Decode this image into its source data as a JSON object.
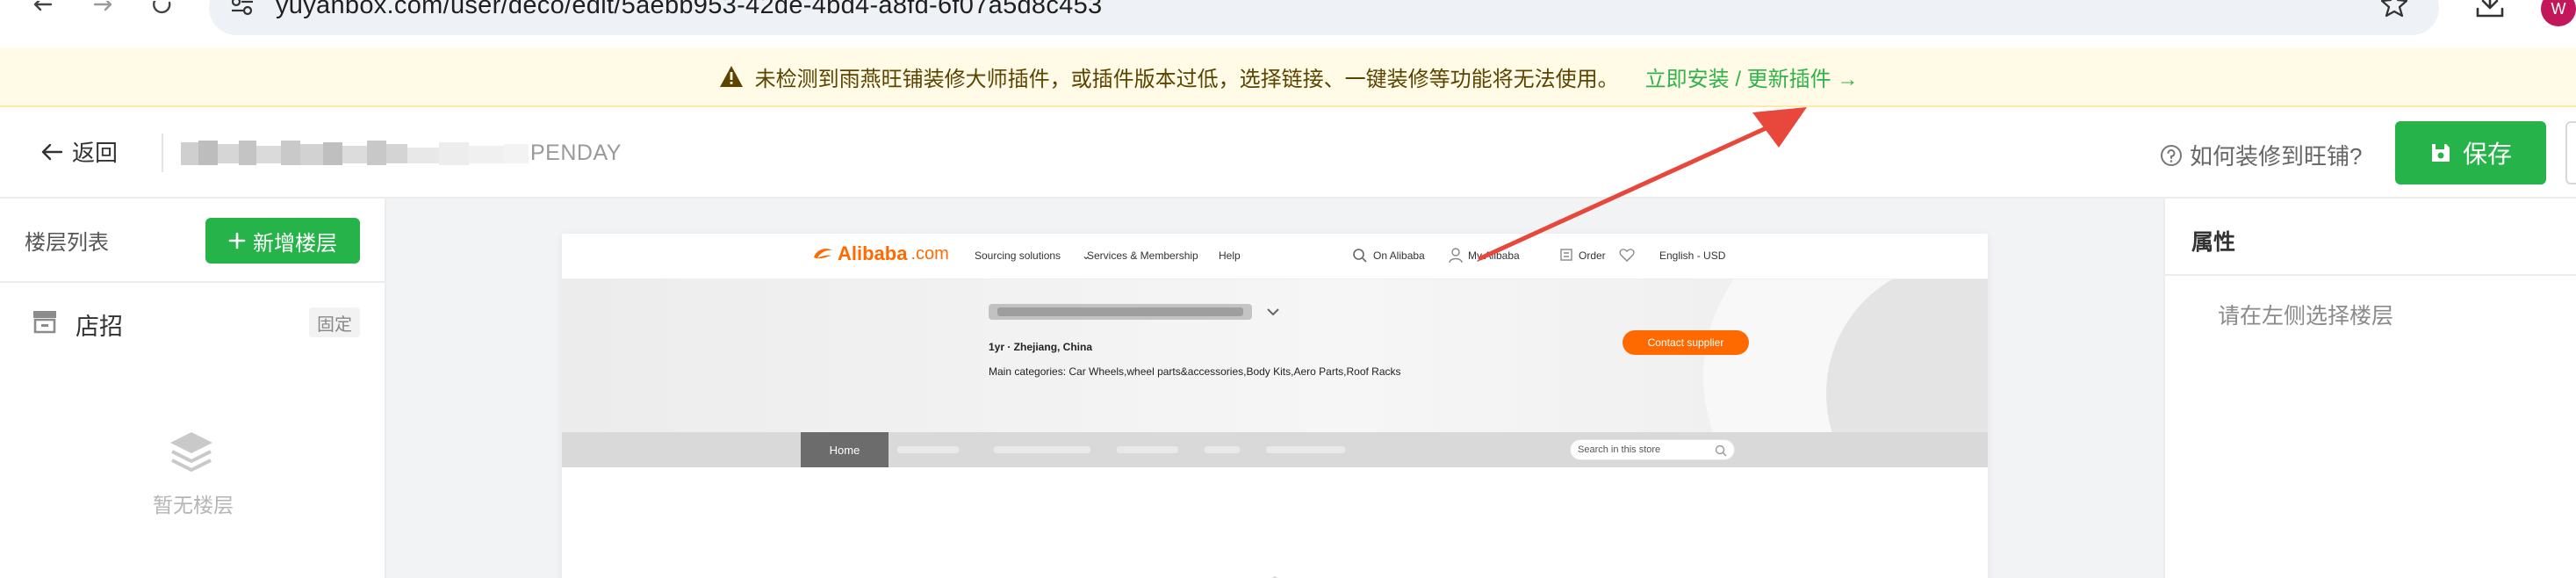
{
  "browser": {
    "url": "yuyanbox.com/user/deco/edit/5aebb953-42de-4bd4-a8fd-6f07a5d8c453",
    "avatar_initial": "W"
  },
  "banner": {
    "message": "未检测到雨燕旺铺装修大师插件，或插件版本过低，选择链接、一键装修等功能将无法使用。",
    "link": "立即安装 / 更新插件 →"
  },
  "header": {
    "back_label": "返回",
    "shop_suffix": "PENDAY",
    "help_label": "如何装修到旺铺?",
    "save_label": "保存"
  },
  "left_panel": {
    "title": "楼层列表",
    "add_label": "新增楼层",
    "store_label": "店招",
    "fixed_badge": "固定",
    "empty_text": "暂无楼层"
  },
  "preview": {
    "logo_main": "Alibaba",
    "logo_suffix": ".com",
    "nav": {
      "sourcing": "Sourcing solutions",
      "services": "Services & Membership",
      "help": "Help",
      "on_alibaba": "On Alibaba",
      "my_alibaba": "My Alibaba",
      "order": "Order",
      "language": "English - USD"
    },
    "company_meta": "1yr  ·  Zhejiang, China",
    "main_categories": "Main categories: Car Wheels,wheel parts&accessories,Body Kits,Aero Parts,Roof Racks",
    "contact_label": "Contact supplier",
    "home_tab": "Home",
    "search_placeholder": "Search in this store"
  },
  "right_panel": {
    "title": "属性",
    "hint": "请在左侧选择楼层"
  },
  "colors": {
    "accent_green": "#26b34a",
    "alibaba_orange": "#ff6a00",
    "banner_bg": "#fffbe6",
    "annotation_red": "#e8473b"
  }
}
